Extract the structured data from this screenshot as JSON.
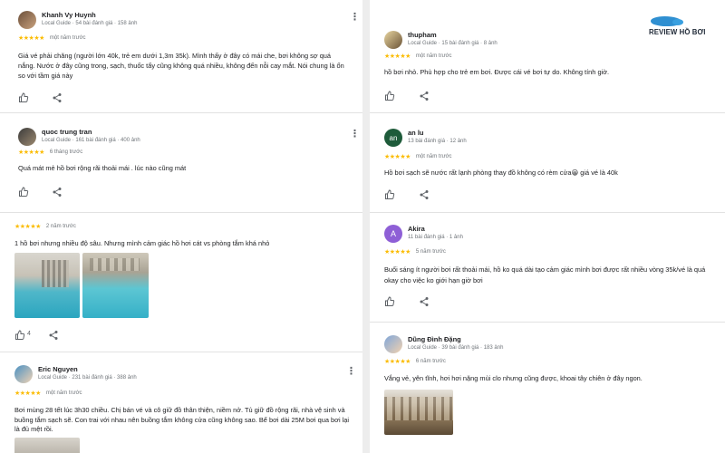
{
  "brand": {
    "label": "REVIEW HỒ BƠI",
    "color": "#2f8fd1"
  },
  "accent_colors": {
    "star": "#fbbc04",
    "meta_text": "#70757a",
    "avatar_an": "#1e5b3a",
    "avatar_akira": "#8e5fd6"
  },
  "reviews": {
    "khanh": {
      "name": "Khanh Vy Huynh",
      "meta": "Local Guide · 54 bài đánh giá · 158 ảnh",
      "stars": "★★★★★",
      "time": "một năm trước",
      "text": "Giá vé phải chăng (người lớn 40k, trẻ em dưới 1,3m 35k). Mình thấy ở đây có mái che, bơi không sợ quá nắng. Nước ở đây cũng trong, sạch, thuốc tẩy cũng không quá nhiều, không đến nỗi cay mắt. Nói chung là ổn so với tầm giá này"
    },
    "quoc": {
      "name": "quoc trung tran",
      "meta": "Local Guide · 161 bài đánh giá · 400 ảnh",
      "stars": "★★★★★",
      "time": "6 tháng trước",
      "text": "Quá mát mẻ hồ bơi rộng rãi thoải mái . lúc nào cũng mát"
    },
    "partial": {
      "stars": "★★★★★",
      "time": "2 năm trước",
      "text": "1 hồ bơi nhưng nhiều độ sâu. Nhưng mình cảm giác hồ hơi cát vs phòng tắm khá nhỏ",
      "likes": "4"
    },
    "eric": {
      "name": "Eric Nguyen",
      "meta": "Local Guide · 231 bài đánh giá · 388 ảnh",
      "stars": "★★★★★",
      "time": "một năm trước",
      "text": "Bơi mùng 28 tết lúc 3h30 chiều. Chị bán vé và cô giữ đồ thân thiện, niềm nở. Tủ giữ đồ rộng rãi, nhà vệ sinh và buồng tắm sạch sẽ. Con trai với nhau nên buồng tắm không cửa cũng không sao. Bể bơi dài 25M bơi qua bơi lại là đủ mệt rồi."
    },
    "thupham": {
      "name": "thupham",
      "meta": "Local Guide · 15 bài đánh giá · 8 ảnh",
      "stars": "★★★★★",
      "time": "một năm trước",
      "text": "hồ bơi nhỏ. Phù hợp cho trẻ em bơi. Được cái vé bơi tự do. Không tính giờ."
    },
    "anlu": {
      "initials": "an",
      "name": "an lu",
      "meta": "13 bài đánh giá · 12 ảnh",
      "stars": "★★★★★",
      "time": "một năm trước",
      "text": "Hồ bơi sạch sẽ nước rất lạnh phòng thay đồ không có rèm cửa😀 giá vé là 40k"
    },
    "akira": {
      "initials": "A",
      "name": "Akira",
      "meta": "11 bài đánh giá · 1 ảnh",
      "stars": "★★★★★",
      "time": "5 năm trước",
      "text": "Buổi sáng ít người bơi rất thoải mái, hồ ko quá dài tạo cảm giác mình bơi được rất nhiều vòng 35k/vé là quá okay cho việc ko giới hạn giờ bơi"
    },
    "dung": {
      "name": "Dũng Đình Đặng",
      "meta": "Local Guide · 39 bài đánh giá · 183 ảnh",
      "stars": "★★★★★",
      "time": "6 năm trước",
      "text": "Vắng vẻ, yên tĩnh, hơi hơi nặng mùi clo nhưng cũng được, khoai tây chiên ở đây ngon."
    }
  }
}
